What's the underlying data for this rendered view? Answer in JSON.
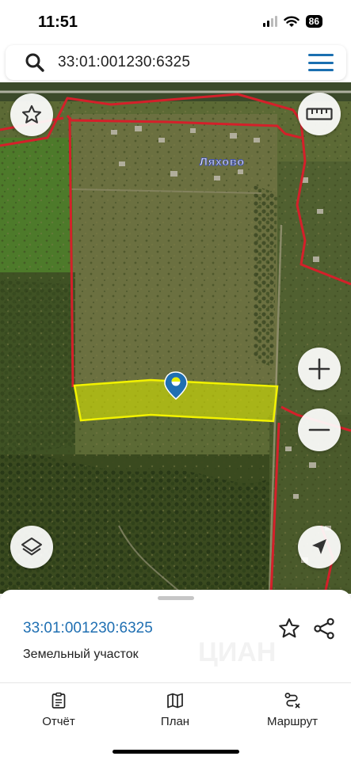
{
  "status_bar": {
    "time": "11:51",
    "battery": "86"
  },
  "search": {
    "value": "33:01:001230:6325"
  },
  "map": {
    "village_label": "Ляхово",
    "parcel_color": "#e8f000",
    "boundary_color": "#d4202a",
    "pin_color": "#1f6fb2",
    "buttons": {
      "favorite": "star-icon",
      "ruler": "ruler-icon",
      "zoom_in": "plus-icon",
      "zoom_out": "minus-icon",
      "layers": "layers-icon",
      "locate": "navigation-arrow-icon"
    }
  },
  "card": {
    "cadastral_number": "33:01:001230:6325",
    "object_type": "Земельный участок",
    "watermark": "ЦИАН"
  },
  "tabs": [
    {
      "label": "Отчёт",
      "icon": "report-icon"
    },
    {
      "label": "План",
      "icon": "map-plan-icon"
    },
    {
      "label": "Маршрут",
      "icon": "route-icon"
    }
  ]
}
